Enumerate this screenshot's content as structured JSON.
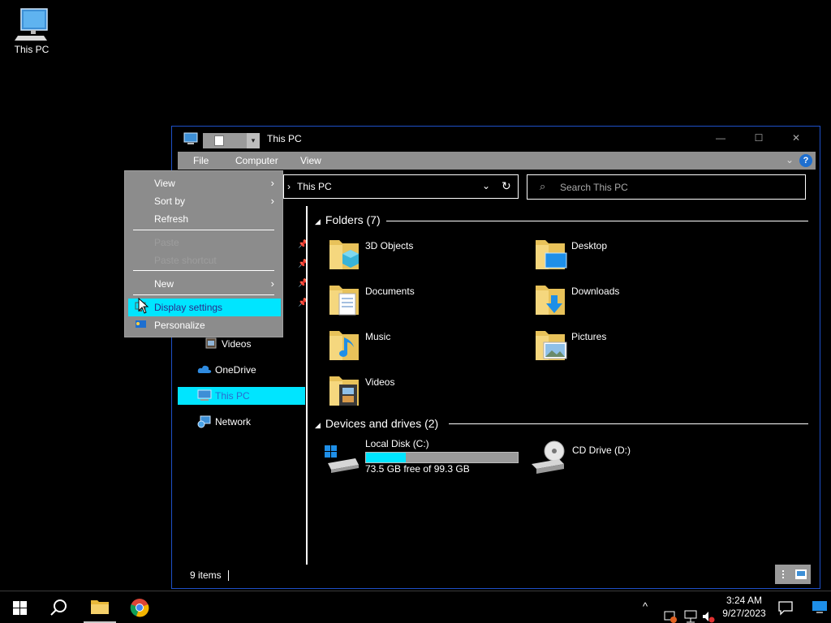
{
  "desktop": {
    "icons": [
      {
        "label": "This PC",
        "icon": "this-pc-icon"
      }
    ]
  },
  "window": {
    "title": "This PC",
    "controls": {
      "minimize": "—",
      "maximize": "☐",
      "close": "✕"
    },
    "ribbon": {
      "tabs": [
        "File",
        "Computer",
        "View"
      ],
      "expand_icon": "chevron-down-icon",
      "help": "?"
    },
    "address": {
      "path": "This PC",
      "crumb_arrow": "›",
      "dropdown": "⌄",
      "refresh": "↻"
    },
    "search": {
      "placeholder": "Search This PC"
    },
    "nav": {
      "items": [
        {
          "label": "Videos",
          "icon": "videos-icon"
        },
        {
          "label": "OneDrive",
          "icon": "onedrive-icon"
        },
        {
          "label": "This PC",
          "icon": "this-pc-icon",
          "selected": true
        },
        {
          "label": "Network",
          "icon": "network-icon"
        }
      ]
    },
    "folders": {
      "header": "Folders (7)",
      "items": [
        {
          "label": "3D Objects",
          "icon": "3d-objects-folder-icon"
        },
        {
          "label": "Desktop",
          "icon": "desktop-folder-icon"
        },
        {
          "label": "Documents",
          "icon": "documents-folder-icon"
        },
        {
          "label": "Downloads",
          "icon": "downloads-folder-icon"
        },
        {
          "label": "Music",
          "icon": "music-folder-icon"
        },
        {
          "label": "Pictures",
          "icon": "pictures-folder-icon"
        },
        {
          "label": "Videos",
          "icon": "videos-folder-icon"
        }
      ]
    },
    "drives": {
      "header": "Devices and drives (2)",
      "items": [
        {
          "label": "Local Disk (C:)",
          "free": "73.5 GB free of 99.3 GB",
          "used_fraction": 0.26,
          "icon": "local-disk-icon"
        },
        {
          "label": "CD Drive (D:)",
          "icon": "cd-drive-icon"
        }
      ]
    },
    "status": {
      "items": "9 items"
    }
  },
  "context_menu": {
    "items": [
      {
        "label": "View",
        "submenu": true
      },
      {
        "label": "Sort by",
        "submenu": true
      },
      {
        "label": "Refresh"
      },
      {
        "label": "Paste",
        "disabled": true
      },
      {
        "label": "Paste shortcut",
        "disabled": true
      },
      {
        "label": "New",
        "submenu": true
      },
      {
        "label": "Display settings",
        "highlighted": true,
        "icon": "display-settings-icon"
      },
      {
        "label": "Personalize",
        "icon": "personalize-icon"
      }
    ]
  },
  "taskbar": {
    "clock": {
      "time": "3:24 AM",
      "date": "9/27/2023"
    },
    "apps": [
      "file-explorer-icon",
      "chrome-icon"
    ]
  },
  "colors": {
    "accent": "#00e5ff",
    "window_border": "#1e50c8",
    "menu_bg": "#8c8c8c"
  }
}
